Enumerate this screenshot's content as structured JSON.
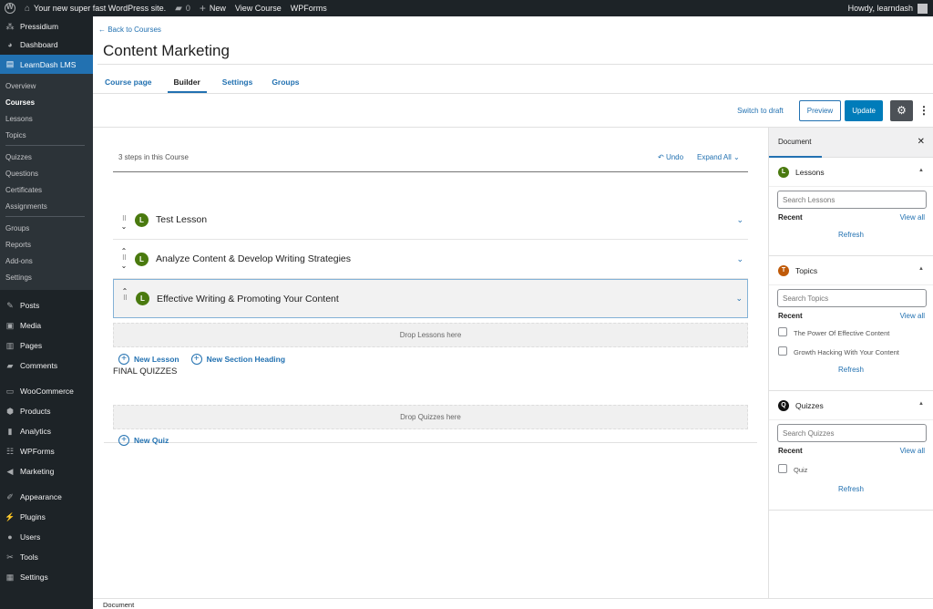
{
  "adminbar": {
    "site_name": "Your new super fast WordPress site.",
    "comments_count": "0",
    "new_label": "New",
    "view_course": "View Course",
    "wpforms": "WPForms",
    "howdy": "Howdy, learndash"
  },
  "sidebar": {
    "top": [
      {
        "label": "Pressidium",
        "icon": "pressidium-icon"
      },
      {
        "label": "Dashboard",
        "icon": "dashboard-icon"
      },
      {
        "label": "LearnDash LMS",
        "icon": "learndash-icon"
      }
    ],
    "submenu": [
      "Overview",
      "Courses",
      "Lessons",
      "Topics",
      "Quizzes",
      "Questions",
      "Certificates",
      "Assignments",
      "Groups",
      "Reports",
      "Add-ons",
      "Settings"
    ],
    "current_sub": "Courses",
    "items": [
      {
        "label": "Posts",
        "icon": "pin-icon"
      },
      {
        "label": "Media",
        "icon": "media-icon"
      },
      {
        "label": "Pages",
        "icon": "pages-icon"
      },
      {
        "label": "Comments",
        "icon": "comment-icon"
      },
      {
        "label": "WooCommerce",
        "icon": "woo-icon"
      },
      {
        "label": "Products",
        "icon": "box-icon"
      },
      {
        "label": "Analytics",
        "icon": "bar-chart-icon"
      },
      {
        "label": "WPForms",
        "icon": "form-icon"
      },
      {
        "label": "Marketing",
        "icon": "megaphone-icon"
      },
      {
        "label": "Appearance",
        "icon": "brush-icon"
      },
      {
        "label": "Plugins",
        "icon": "plug-icon"
      },
      {
        "label": "Users",
        "icon": "user-icon"
      },
      {
        "label": "Tools",
        "icon": "wrench-icon"
      },
      {
        "label": "Settings",
        "icon": "settings-icon"
      }
    ]
  },
  "header": {
    "back_link": "← Back to Courses",
    "title": "Content Marketing",
    "tabs": [
      "Course page",
      "Builder",
      "Settings",
      "Groups"
    ],
    "active_tab": "Builder"
  },
  "toolbar": {
    "switch_draft": "Switch to draft",
    "preview": "Preview",
    "update": "Update"
  },
  "builder": {
    "steps_count": "3 steps in this Course",
    "undo": "Undo",
    "expand_all": "Expand All",
    "lessons": [
      {
        "badge": "L",
        "title": "Test Lesson"
      },
      {
        "badge": "L",
        "title": "Analyze Content & Develop Writing Strategies"
      },
      {
        "badge": "L",
        "title": "Effective Writing & Promoting Your Content"
      }
    ],
    "drop_lessons": "Drop Lessons here",
    "new_lesson": "New Lesson",
    "new_section": "New Section Heading",
    "final_quizzes": "FINAL QUIZZES",
    "drop_quizzes": "Drop Quizzes here",
    "new_quiz": "New Quiz"
  },
  "sidepanel": {
    "tab": "Document",
    "lessons": {
      "badge": "L",
      "color": "#4a7a0f",
      "title": "Lessons",
      "search_placeholder": "Search Lessons",
      "recent": "Recent",
      "view_all": "View all",
      "refresh": "Refresh"
    },
    "topics": {
      "badge": "T",
      "color": "#c05a08",
      "title": "Topics",
      "search_placeholder": "Search Topics",
      "recent": "Recent",
      "view_all": "View all",
      "refresh": "Refresh",
      "items": [
        "The Power Of Effective Content",
        "Growth Hacking With Your Content"
      ]
    },
    "quizzes": {
      "badge": "Q",
      "color": "#111111",
      "title": "Quizzes",
      "search_placeholder": "Search Quizzes",
      "recent": "Recent",
      "view_all": "View all",
      "refresh": "Refresh",
      "items": [
        "Quiz"
      ]
    }
  },
  "footer": {
    "label": "Document"
  }
}
